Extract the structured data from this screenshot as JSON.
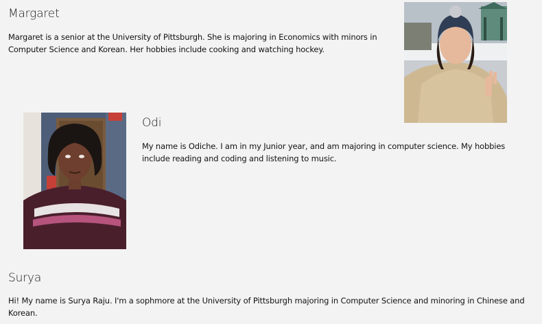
{
  "profiles": [
    {
      "name": "Margaret",
      "bio": "Margaret is a senior at the University of Pittsburgh. She is majoring in Economics with minors in Computer Science and Korean. Her hobbies include cooking and watching hockey."
    },
    {
      "name": "Odi",
      "bio": "My name is Odiche. I am in my Junior year, and am majoring in computer science. My hobbies include reading and coding and listening to music."
    },
    {
      "name": "Surya",
      "bio": "Hi! My name is Surya Raju. I'm a sophmore at the University of Pittsburgh majoring in Computer Science and minoring in Chinese and Korean."
    }
  ]
}
